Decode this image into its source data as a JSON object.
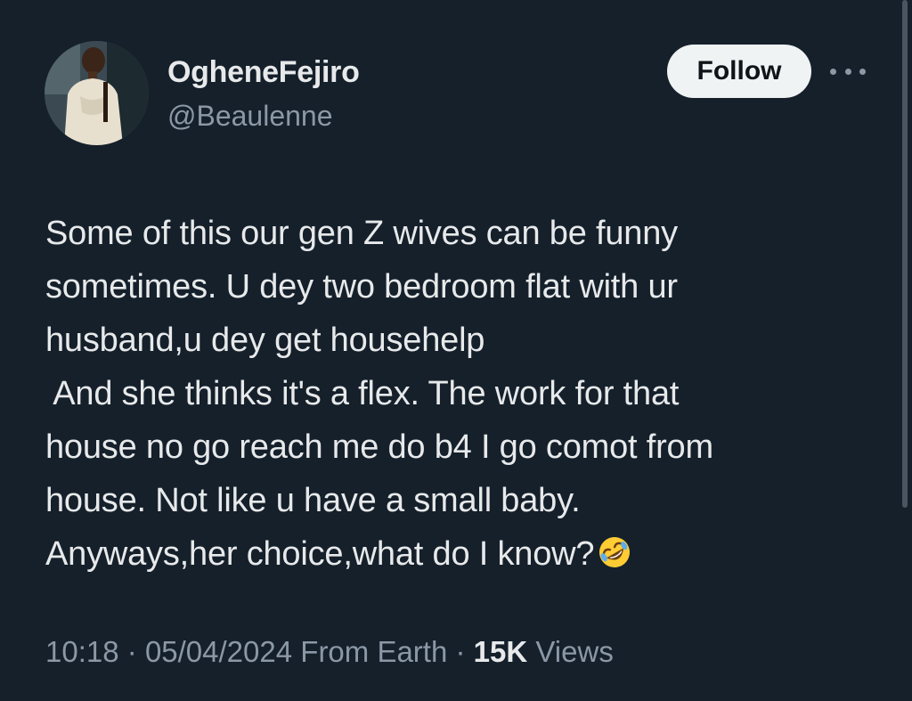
{
  "author": {
    "display_name": "OgheneFejiro",
    "handle": "@Beaulenne"
  },
  "actions": {
    "follow_label": "Follow",
    "more_icon": "more-horizontal-icon"
  },
  "tweet": {
    "lines": [
      "Some of this our gen Z wives can be funny",
      "sometimes. U dey two bedroom flat with ur",
      "husband,u dey get househelp",
      " And she thinks it's a flex. The work for that",
      "house no go reach me do b4 I go comot from",
      "house. Not like u have a small baby.",
      "Anyways,her choice,what do I know?"
    ],
    "emoji": "rolling-on-floor-laughing-emoji"
  },
  "meta": {
    "time": "10:18",
    "separator": "·",
    "date": "05/04/2024",
    "location": "From Earth",
    "views_count": "15K",
    "views_label": "Views"
  },
  "colors": {
    "background": "#15202b",
    "text_primary": "#e7e9ea",
    "text_secondary": "#8b98a5",
    "follow_bg": "#eff3f4",
    "emoji_yellow": "#ffcc33"
  }
}
